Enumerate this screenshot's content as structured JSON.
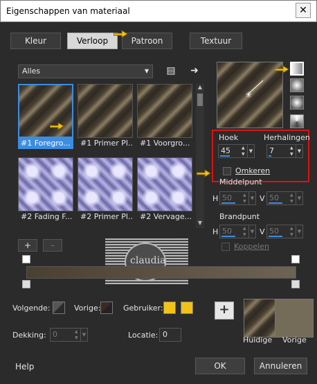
{
  "window": {
    "title": "Eigenschappen van materiaal",
    "close": "✕"
  },
  "tabs": [
    {
      "label": "Kleur",
      "active": false
    },
    {
      "label": "Verloop",
      "active": true
    },
    {
      "label": "Patroon",
      "active": false
    },
    {
      "label": "Textuur",
      "active": false
    }
  ],
  "category": {
    "value": "Alles"
  },
  "swatches": [
    {
      "caption": "#1 Foregro...",
      "kind": "stripes",
      "selected": true
    },
    {
      "caption": "#1 Primer Pl...",
      "kind": "stripes",
      "selected": false
    },
    {
      "caption": "#1 Voorgro...",
      "kind": "stripes",
      "selected": false
    },
    {
      "caption": "#2 Fading F...",
      "kind": "fading",
      "selected": false
    },
    {
      "caption": "#2 Primer Pl...",
      "kind": "fading",
      "selected": false
    },
    {
      "caption": "#2 Vervage...",
      "kind": "fading",
      "selected": false
    }
  ],
  "list_buttons": {
    "add": "+",
    "remove": "-"
  },
  "settings": {
    "hoek_label": "Hoek",
    "hoek_value": "45",
    "herhalingen_label": "Herhalingen",
    "herhalingen_value": "7",
    "omkeren_label": "Omkeren",
    "middelpunt_label": "Middelpunt",
    "mid_h_label": "H",
    "mid_h_value": "50",
    "mid_v_label": "V",
    "mid_v_value": "50",
    "brandpunt_label": "Brandpunt",
    "brand_h_label": "H",
    "brand_h_value": "50",
    "brand_v_label": "V",
    "brand_v_value": "50",
    "koppelen_label": "Koppelen"
  },
  "watermark": {
    "text": "claudia"
  },
  "colors": {
    "volgende_label": "Volgende:",
    "vorige_label": "Vorige:",
    "gebruiker_label": "Gebruiker:",
    "gebruiker_color_1": "#f2c21a",
    "gebruiker_color_2": "#f2c21a",
    "accent": "#3c8de0",
    "highlight": "#d91414"
  },
  "dekking": {
    "label": "Dekking:",
    "value": "0"
  },
  "locatie": {
    "label": "Locatie:",
    "value": "0"
  },
  "preview": {
    "huidige_label": "Huidige",
    "vorige_label": "Vorige"
  },
  "footer": {
    "help": "Help",
    "ok": "OK",
    "cancel": "Annuleren"
  }
}
